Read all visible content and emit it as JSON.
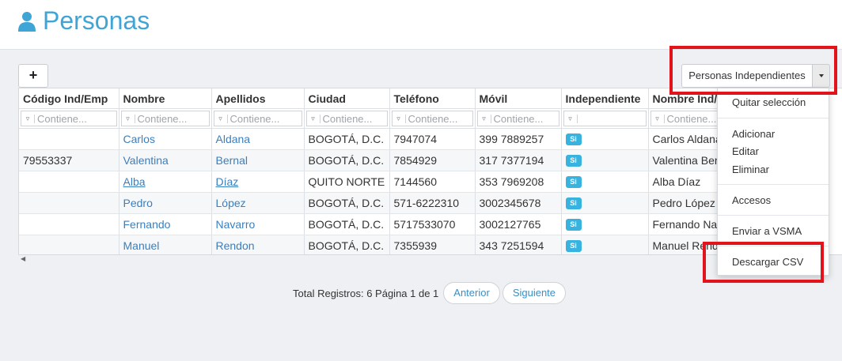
{
  "header": {
    "title": "Personas",
    "icon": "user-icon",
    "accent": "#3fa5d6"
  },
  "toolbar": {
    "add_label": "+",
    "view_selector": "Personas Independientes"
  },
  "grid": {
    "columns": [
      "Código Ind/Emp",
      "Nombre",
      "Apellidos",
      "Ciudad",
      "Teléfono",
      "Móvil",
      "Independiente",
      "Nombre Ind/Emp"
    ],
    "filter_placeholder": "Contiene...",
    "rows": [
      {
        "codigo": "",
        "nombre": "Carlos",
        "apellidos": "Aldana",
        "ciudad": "BOGOTÁ, D.C.",
        "telefono": "7947074",
        "movil": "399 7889257",
        "independiente": "Si",
        "nombre_ind": "Carlos Aldana"
      },
      {
        "codigo": "79553337",
        "nombre": "Valentina",
        "apellidos": "Bernal",
        "ciudad": "BOGOTÁ, D.C.",
        "telefono": "7854929",
        "movil": "317 7377194",
        "independiente": "Si",
        "nombre_ind": "Valentina Bernal"
      },
      {
        "codigo": "",
        "nombre": "Alba",
        "apellidos": "Díaz",
        "ciudad": "QUITO NORTE",
        "telefono": "7144560",
        "movil": "353 7969208",
        "independiente": "Si",
        "nombre_ind": "Alba Díaz"
      },
      {
        "codigo": "",
        "nombre": "Pedro",
        "apellidos": "López",
        "ciudad": "BOGOTÁ, D.C.",
        "telefono": "571-6222310",
        "movil": "3002345678",
        "independiente": "Si",
        "nombre_ind": "Pedro López"
      },
      {
        "codigo": "",
        "nombre": "Fernando",
        "apellidos": "Navarro",
        "ciudad": "BOGOTÁ, D.C.",
        "telefono": "5717533070",
        "movil": "3002127765",
        "independiente": "Si",
        "nombre_ind": "Fernando Navarro"
      },
      {
        "codigo": "",
        "nombre": "Manuel",
        "apellidos": "Rendon",
        "ciudad": "BOGOTÁ, D.C.",
        "telefono": "7355939",
        "movil": "343 7251594",
        "independiente": "Si",
        "nombre_ind": "Manuel Rendon"
      }
    ]
  },
  "menu": {
    "items": [
      {
        "label": "Quitar selección"
      },
      {
        "label": "Adicionar"
      },
      {
        "label": "Editar"
      },
      {
        "label": "Eliminar"
      },
      {
        "label": "Accesos"
      },
      {
        "label": "Enviar a VSMA"
      },
      {
        "label": "Descargar CSV"
      }
    ]
  },
  "pager": {
    "summary": "Total Registros: 6 Página 1 de 1",
    "prev_label": "Anterior",
    "next_label": "Siguiente"
  },
  "colors": {
    "link": "#3a7fbf",
    "badge": "#38b3e0",
    "highlight": "#e0141a"
  }
}
